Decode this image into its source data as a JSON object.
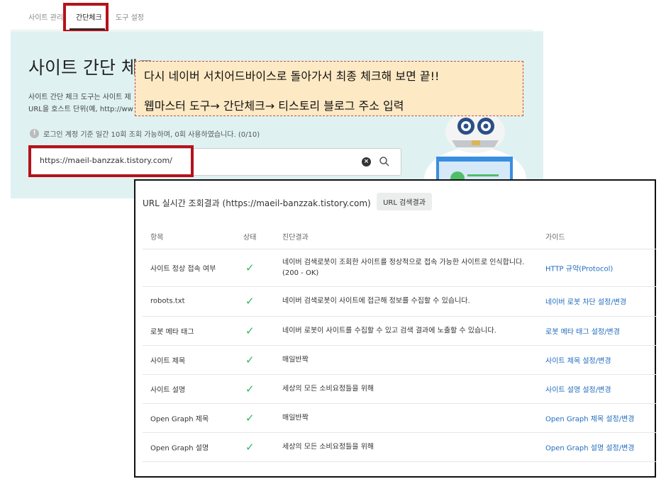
{
  "nav": {
    "tabs": [
      {
        "label": "사이트 관리"
      },
      {
        "label": "간단체크"
      },
      {
        "label": "도구 설정"
      }
    ]
  },
  "hero": {
    "title": "사이트 간단 체크",
    "desc_line1": "사이트 간단 체크 도구는 사이트 제",
    "desc_line2": "URL을 호스트 단위(예, http://ww",
    "notice": "로그인 계정 기준 일간 10회 조회 가능하며, 0회 사용하였습니다. (0/10)",
    "notice_icon": "!",
    "url_value": "https://maeil-banzzak.tistory.com/",
    "clear_icon": "×"
  },
  "callout": {
    "line1": "다시 네이버 서치어드바이스로 돌아가서 최종 체크해 보면 끝!!",
    "line2": "웹마스터 도구→ 간단체크→ 티스토리 블로그 주소 입력"
  },
  "results": {
    "title": "URL 실시간 조회결과 (https://maeil-banzzak.tistory.com)",
    "button": "URL 검색결과",
    "headers": {
      "item": "항목",
      "status": "상태",
      "diagnosis": "진단결과",
      "guide": "가이드"
    },
    "check_icon": "✓",
    "rows": [
      {
        "item": "사이트 정상 접속 여부",
        "diagnosis": "네이버 검색로봇이 조회한 사이트를 정상적으로 접속 가능한 사이트로 인식합니다.\n(200 - OK)",
        "guide": "HTTP 규약(Protocol)"
      },
      {
        "item": "robots.txt",
        "diagnosis": "네이버 검색로봇이 사이트에 접근해 정보를 수집할 수 있습니다.",
        "guide": "네이버 로봇 차단 설정/변경"
      },
      {
        "item": "로봇 메타 태그",
        "diagnosis": "네이버 로봇이 사이트를 수집할 수 있고 검색 결과에 노출할 수 있습니다.",
        "guide": "로봇 메타 태그 설정/변경"
      },
      {
        "item": "사이트 제목",
        "diagnosis": "매일반짝",
        "guide": "사이트 제목 설정/변경"
      },
      {
        "item": "사이트 설명",
        "diagnosis": "세상의 모든 소비요정들을 위해",
        "guide": "사이트 설명 설정/변경"
      },
      {
        "item": "Open Graph 제목",
        "diagnosis": "매일반짝",
        "guide": "Open Graph 제목 설정/변경"
      },
      {
        "item": "Open Graph 설명",
        "diagnosis": "세상의 모든 소비요정들을 위해",
        "guide": "Open Graph 설명 설정/변경"
      }
    ]
  }
}
